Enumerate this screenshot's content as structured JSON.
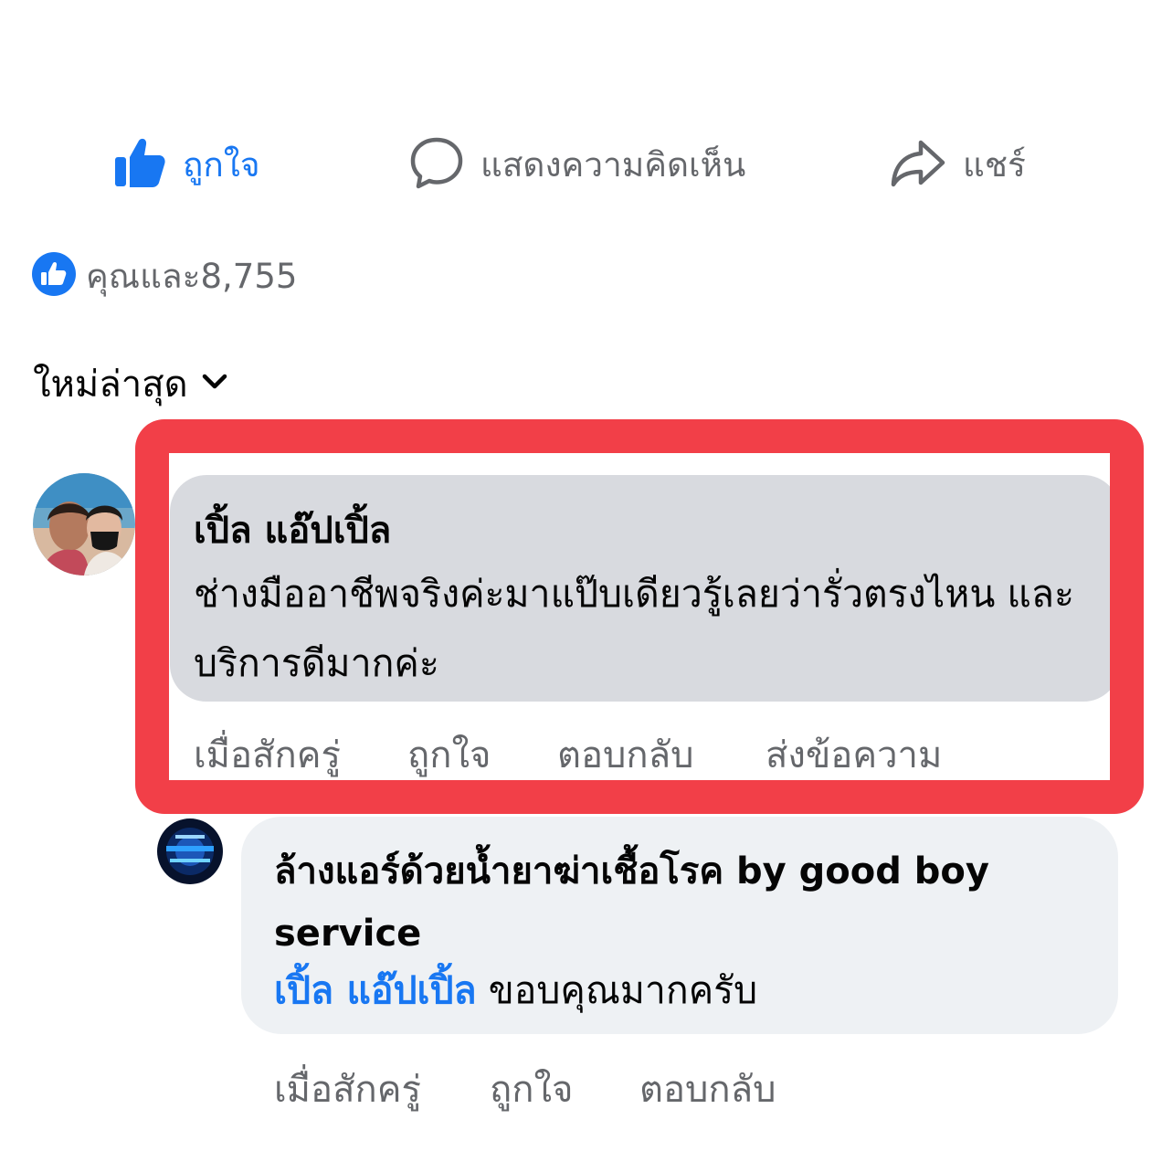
{
  "actions": {
    "like_label": "ถูกใจ",
    "comment_label": "แสดงความคิดเห็น",
    "share_label": "แชร์"
  },
  "reactions": {
    "icon": "like-icon",
    "summary": "คุณและ8,755"
  },
  "sort": {
    "label": "ใหม่ล่าสุด",
    "icon": "chevron-down-icon"
  },
  "comments": [
    {
      "author": "เปิ้ล แอ๊ปเปิ้ล",
      "text": "ช่างมืออาชีพจริงค่ะมาแป๊บเดียวรู้เลยว่ารั่วตรงไหน และบริการดีมากค่ะ",
      "time": "เมื่อสักครู่",
      "like_label": "ถูกใจ",
      "reply_label": "ตอบกลับ",
      "message_label": "ส่งข้อความ",
      "highlight_color": "#f23f48"
    }
  ],
  "reply": {
    "author": "ล้างแอร์ด้วยน้ำยาฆ่าเชื้อโรค by good boy service",
    "mention": "เปิ้ล แอ๊ปเปิ้ล",
    "text": " ขอบคุณมากครับ",
    "time": "เมื่อสักครู่",
    "like_label": "ถูกใจ",
    "reply_label": "ตอบกลับ"
  },
  "colors": {
    "accent": "#1877f2",
    "secondary_text": "#65676b",
    "bubble": "#d8dadf",
    "reply_bubble": "#eef1f4"
  }
}
